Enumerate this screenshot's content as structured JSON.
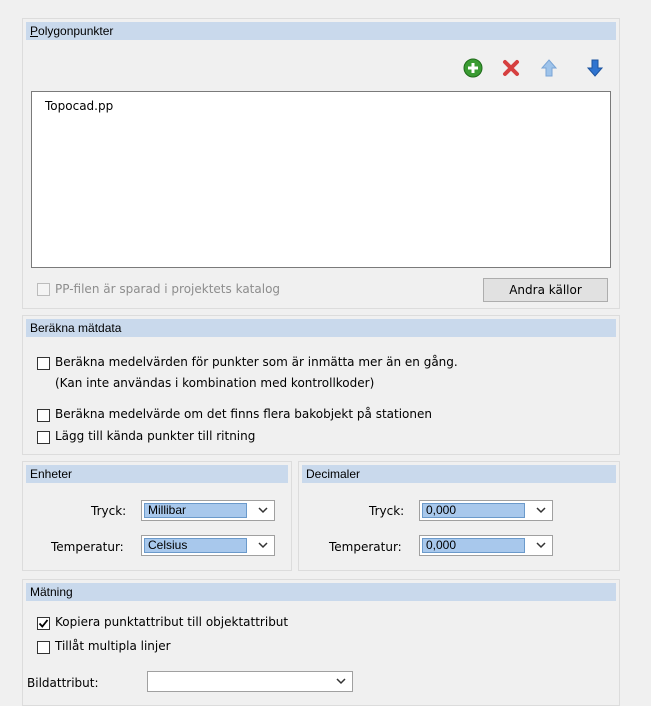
{
  "polygon": {
    "title_underline": "P",
    "title_rest": "olygonpunkter",
    "list_items": [
      "Topocad.pp"
    ],
    "pp_checkbox_label": "PP-filen är sparad i projektets katalog",
    "pp_checked": false,
    "change_sources_label": "Andra källor"
  },
  "compute": {
    "title": "Beräkna mätdata",
    "option1_line1": "Beräkna medelvärden för punkter som är inmätta mer än en gång.",
    "option1_line2": "(Kan inte användas i kombination med kontrollkoder)",
    "option2": "Beräkna medelvärde om det finns flera bakobjekt på stationen",
    "option3": "Lägg till kända punkter till ritning",
    "option1_checked": false,
    "option2_checked": false,
    "option3_checked": false
  },
  "units": {
    "title": "Enheter",
    "pressure_label": "Tryck:",
    "pressure_value": "Millibar",
    "temperature_label": "Temperatur:",
    "temperature_value": "Celsius"
  },
  "decimals": {
    "title": "Decimaler",
    "pressure_label": "Tryck:",
    "pressure_value": "0,000",
    "temperature_label": "Temperatur:",
    "temperature_value": "0,000"
  },
  "measurement": {
    "title": "Mätning",
    "copy_attr_label": "Kopiera punktattribut till objektattribut",
    "copy_attr_checked": true,
    "multi_lines_label": "Tillåt multipla linjer",
    "multi_lines_checked": false,
    "image_attr_label": "Bildattribut:",
    "image_attr_value": ""
  },
  "icons": {
    "add": "add-icon",
    "delete": "delete-icon",
    "move_up": "arrow-up-icon",
    "move_down": "arrow-down-icon",
    "dropdown": "chevron-down-icon"
  },
  "colors": {
    "header_bg": "#c9d9ec",
    "selection_bg": "#a8c8ec",
    "add_green": "#3a9b32",
    "delete_red": "#d64040",
    "arrow_blue": "#2f74d0"
  }
}
